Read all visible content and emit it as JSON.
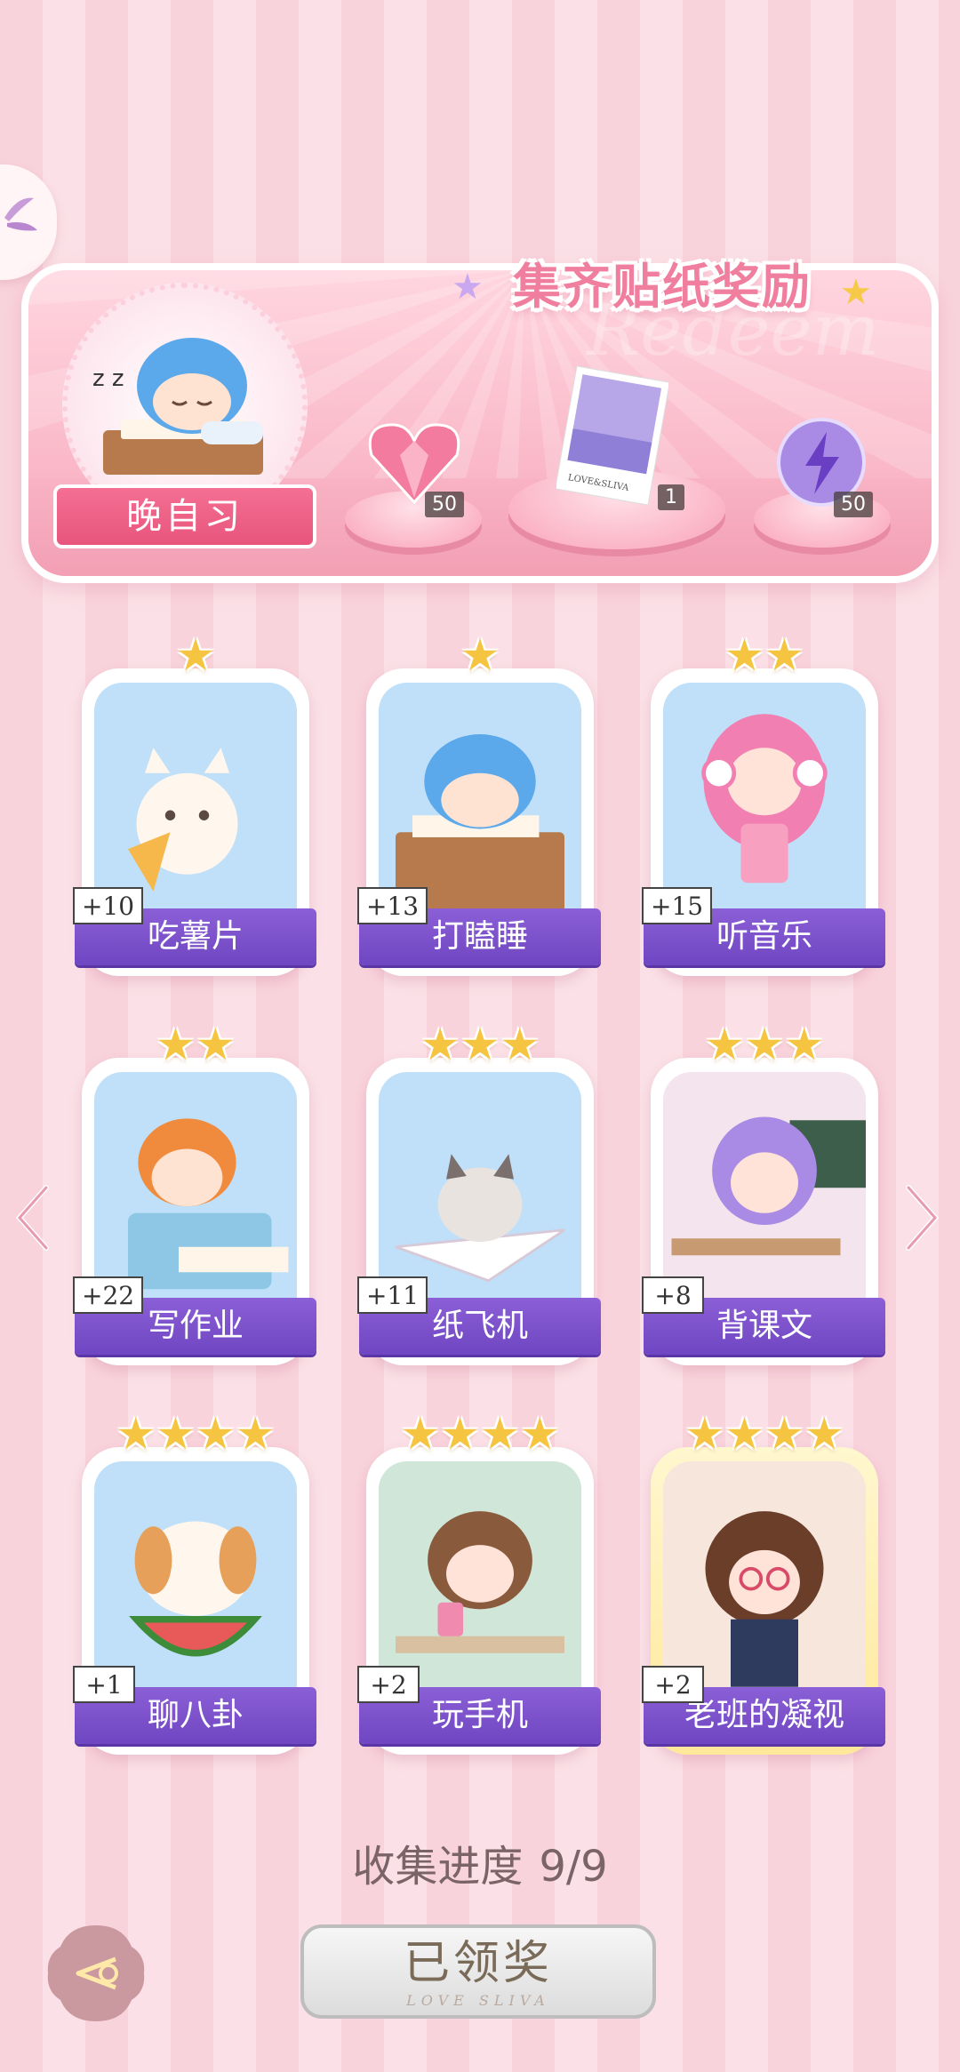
{
  "header": {
    "title": "集齐贴纸奖励",
    "subtitle": "Redeem",
    "character_name": "晚自习"
  },
  "rewards": [
    {
      "icon": "pink-heart-gem-icon",
      "count": "50"
    },
    {
      "icon": "postcard-icon",
      "count": "1",
      "card_text": "LOVE&SLIVA"
    },
    {
      "icon": "purple-lightning-orb-icon",
      "count": "50"
    }
  ],
  "cards": [
    {
      "label": "吃薯片",
      "bonus": "+10",
      "stars": 1,
      "theme": "#bfe0f8",
      "gold": false
    },
    {
      "label": "打瞌睡",
      "bonus": "+13",
      "stars": 1,
      "theme": "#bfe0f8",
      "gold": false
    },
    {
      "label": "听音乐",
      "bonus": "+15",
      "stars": 2,
      "theme": "#bfe0f8",
      "gold": false
    },
    {
      "label": "写作业",
      "bonus": "+22",
      "stars": 2,
      "theme": "#bfe0f8",
      "gold": false
    },
    {
      "label": "纸飞机",
      "bonus": "+11",
      "stars": 3,
      "theme": "#bfe0f8",
      "gold": false
    },
    {
      "label": "背课文",
      "bonus": "+8",
      "stars": 3,
      "theme": "#f4e4ee",
      "gold": false
    },
    {
      "label": "聊八卦",
      "bonus": "+1",
      "stars": 4,
      "theme": "#bfe0f8",
      "gold": false
    },
    {
      "label": "玩手机",
      "bonus": "+2",
      "stars": 4,
      "theme": "#cfe6d9",
      "gold": false
    },
    {
      "label": "老班的凝视",
      "bonus": "+2",
      "stars": 4,
      "theme": "#f6e6dc",
      "gold": true
    }
  ],
  "progress": {
    "label": "收集进度",
    "value": "9/9"
  },
  "claim_button": {
    "label": "已领奖",
    "sub": "LOVE SLIVA"
  }
}
